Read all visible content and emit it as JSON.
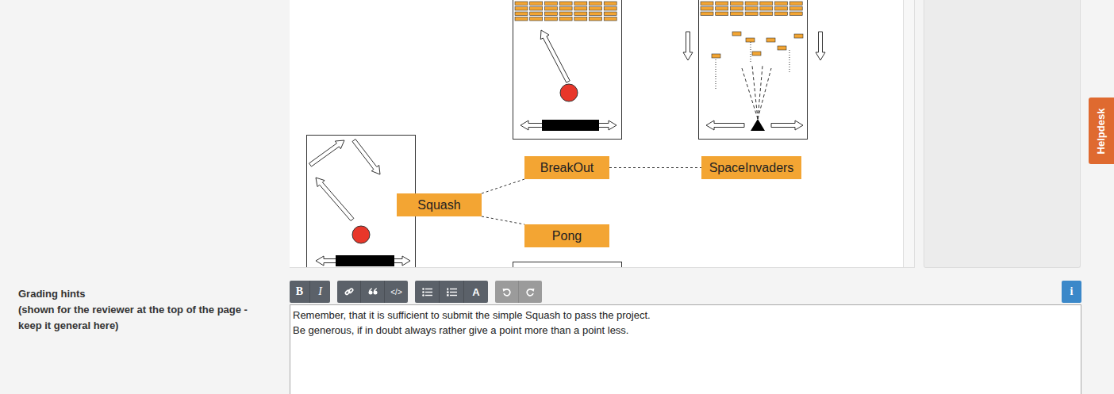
{
  "diagram": {
    "nodes": [
      {
        "label": "Squash",
        "kind": "squash"
      },
      {
        "label": "BreakOut",
        "kind": "breakout"
      },
      {
        "label": "SpaceInvaders",
        "kind": "invaders"
      },
      {
        "label": "Pong",
        "kind": "pong"
      }
    ],
    "edges": [
      {
        "from": "Squash",
        "to": "BreakOut"
      },
      {
        "from": "Squash",
        "to": "Pong"
      },
      {
        "from": "BreakOut",
        "to": "SpaceInvaders"
      }
    ]
  },
  "helpdesk": "Helpdesk",
  "field": {
    "label": "Grading hints",
    "hint": "(shown for the reviewer at the top of the page - keep it general here)"
  },
  "toolbar": {
    "bold": "B",
    "italic": "I",
    "code": "</>",
    "color": "A",
    "info": "i",
    "history_disabled": true
  },
  "editor": {
    "lines": [
      "Remember, that it is sufficient to submit the simple Squash to pass the project.",
      "Be generous, if in doubt always rather give a point more than a point less."
    ]
  }
}
